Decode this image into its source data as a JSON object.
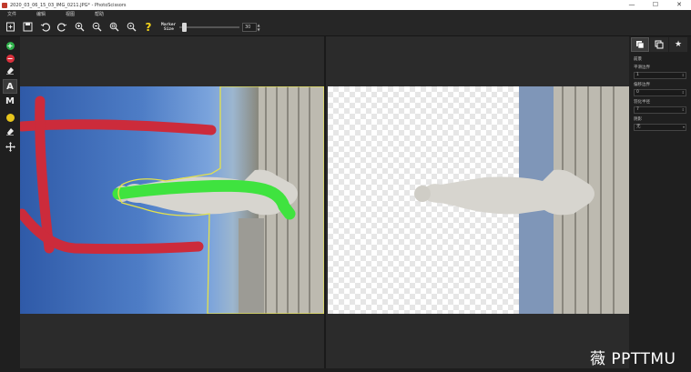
{
  "window": {
    "title": "2020_03_06_15_03_IMG_0211.JPG* - PhotoScissors",
    "min_glyph": "—",
    "max_glyph": "☐",
    "close_glyph": "✕"
  },
  "menu": [
    "文件",
    "编辑",
    "视图",
    "帮助"
  ],
  "toolbar": {
    "icons": [
      "new-file-icon",
      "save-icon",
      "undo-icon",
      "redo-icon",
      "zoom-in-icon",
      "zoom-out-icon",
      "zoom-fit-icon",
      "zoom-actual-icon",
      "help-icon"
    ],
    "help_glyph": "?",
    "marker_size_label_1": "Marker",
    "marker_size_label_2": "Size",
    "marker_size_value": "30",
    "marker_size_fraction": 0.05
  },
  "left_tools": {
    "icons": [
      "add-foreground-icon",
      "remove-background-icon",
      "eraser-icon",
      "text-tool-icon",
      "mask-tool-icon",
      "color-dot-icon",
      "eraser2-icon",
      "move-icon"
    ],
    "text_tool_glyph": "A",
    "mask_tool_glyph": "M",
    "add_glyph": "+",
    "remove_glyph": "−"
  },
  "right_panel": {
    "section": "前景",
    "fields": [
      {
        "label": "平滑边界",
        "value": "1"
      },
      {
        "label": "偏移边界",
        "value": "0"
      },
      {
        "label": "羽化半径",
        "value": "7"
      },
      {
        "label": "阴影",
        "value": "无"
      }
    ]
  },
  "colors": {
    "foreground_marker": "#3fe33f",
    "background_marker": "#cc2b3b",
    "selection_outline": "#e5e24a"
  },
  "watermark": "薇 PPTTMU"
}
